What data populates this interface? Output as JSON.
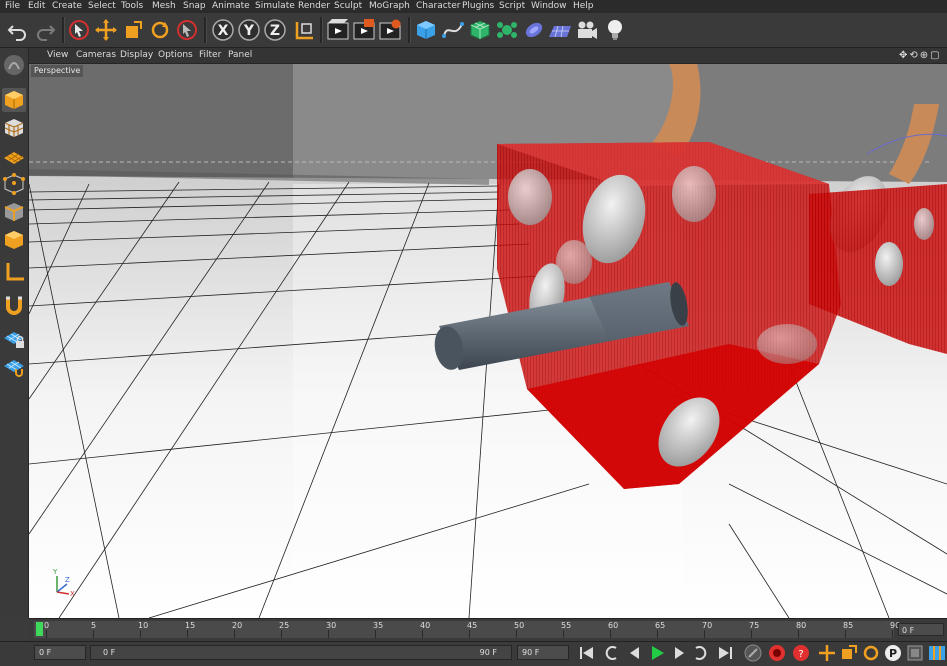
{
  "menu": [
    "File",
    "Edit",
    "Create",
    "Select",
    "Tools",
    "Mesh",
    "Snap",
    "Animate",
    "Simulate",
    "Render",
    "Sculpt",
    "MoGraph",
    "Character",
    "Plugins",
    "Script",
    "Window",
    "Help"
  ],
  "toolbar": {
    "axis_x": "X",
    "axis_y": "Y",
    "axis_z": "Z"
  },
  "viewport_menu": [
    "View",
    "Cameras",
    "Display",
    "Options",
    "Filter",
    "Panel"
  ],
  "viewport": {
    "label": "Perspective",
    "nav_icons": "✥⟲⊕▢",
    "axis_labels": {
      "y": "Y",
      "z": "Z",
      "x": "X"
    }
  },
  "timeline": {
    "ticks": [
      "0",
      "5",
      "10",
      "15",
      "20",
      "25",
      "30",
      "35",
      "40",
      "45",
      "50",
      "55",
      "60",
      "65",
      "70",
      "75",
      "80",
      "85",
      "90"
    ],
    "current_frame": "0 F"
  },
  "bottom": {
    "start_frame": "0 F",
    "preview_min": "0 F",
    "preview_max": "90 F",
    "end_frame": "90 F"
  },
  "colors": {
    "accent_orange": "#f0a020",
    "dice_red": "#d40000",
    "play_green": "#22cc44"
  }
}
